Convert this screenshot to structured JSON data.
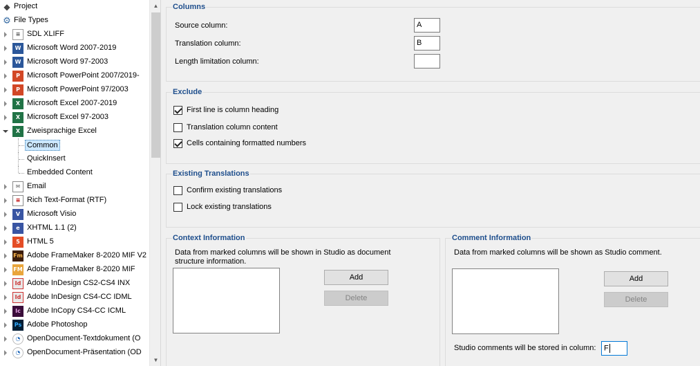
{
  "tree": {
    "items": [
      {
        "label": "Project",
        "icon": "project-icon",
        "cls": "ic-proj",
        "glyph": "◆",
        "depth": 0,
        "arrow": "none"
      },
      {
        "label": "File Types",
        "icon": "gear-icon",
        "cls": "ic-gear",
        "glyph": "⚙",
        "depth": 0,
        "arrow": "none"
      },
      {
        "label": "SDL XLIFF",
        "icon": "sdl-xliff-icon",
        "cls": "ic-plain",
        "glyph": "≡",
        "depth": 1,
        "arrow": "closed"
      },
      {
        "label": "Microsoft Word 2007-2019",
        "icon": "word-icon",
        "cls": "ic-word",
        "glyph": "W",
        "depth": 1,
        "arrow": "closed"
      },
      {
        "label": "Microsoft Word 97-2003",
        "icon": "word-legacy-icon",
        "cls": "ic-word",
        "glyph": "W",
        "depth": 1,
        "arrow": "closed"
      },
      {
        "label": "Microsoft PowerPoint 2007/2019-",
        "icon": "powerpoint-icon",
        "cls": "ic-ppt",
        "glyph": "P",
        "depth": 1,
        "arrow": "closed"
      },
      {
        "label": "Microsoft PowerPoint 97/2003",
        "icon": "powerpoint-legacy-icon",
        "cls": "ic-ppt",
        "glyph": "P",
        "depth": 1,
        "arrow": "closed"
      },
      {
        "label": "Microsoft Excel 2007-2019",
        "icon": "excel-icon",
        "cls": "ic-xl",
        "glyph": "X",
        "depth": 1,
        "arrow": "closed"
      },
      {
        "label": "Microsoft Excel 97-2003",
        "icon": "excel-legacy-icon",
        "cls": "ic-xl",
        "glyph": "X",
        "depth": 1,
        "arrow": "closed"
      },
      {
        "label": "Zweisprachige Excel",
        "icon": "bilingual-excel-icon",
        "cls": "ic-xl",
        "glyph": "X",
        "depth": 1,
        "arrow": "open"
      },
      {
        "label": "Common",
        "icon": "",
        "cls": "",
        "glyph": "",
        "depth": 2,
        "arrow": "none",
        "selected": true
      },
      {
        "label": "QuickInsert",
        "icon": "",
        "cls": "",
        "glyph": "",
        "depth": 2,
        "arrow": "none"
      },
      {
        "label": "Embedded Content",
        "icon": "",
        "cls": "",
        "glyph": "",
        "depth": 2,
        "arrow": "none"
      },
      {
        "label": "Email",
        "icon": "email-icon",
        "cls": "ic-mail",
        "glyph": "✉",
        "depth": 1,
        "arrow": "closed"
      },
      {
        "label": "Rich Text-Format (RTF)",
        "icon": "rtf-icon",
        "cls": "ic-rtf",
        "glyph": "≡",
        "depth": 1,
        "arrow": "closed"
      },
      {
        "label": "Microsoft Visio",
        "icon": "visio-icon",
        "cls": "ic-visio",
        "glyph": "V",
        "depth": 1,
        "arrow": "closed"
      },
      {
        "label": "XHTML 1.1 (2)",
        "icon": "xhtml-icon",
        "cls": "ic-visio",
        "glyph": "e",
        "depth": 1,
        "arrow": "closed"
      },
      {
        "label": "HTML 5",
        "icon": "html5-icon",
        "cls": "ic-html",
        "glyph": "5",
        "depth": 1,
        "arrow": "closed"
      },
      {
        "label": "Adobe FrameMaker 8-2020 MIF V2",
        "icon": "framemaker-icon",
        "cls": "ic-fm",
        "glyph": "Fm",
        "depth": 1,
        "arrow": "closed"
      },
      {
        "label": "Adobe FrameMaker 8-2020 MIF",
        "icon": "framemaker-legacy-icon",
        "cls": "ic-fm2",
        "glyph": "FM",
        "depth": 1,
        "arrow": "closed"
      },
      {
        "label": "Adobe InDesign CS2-CS4 INX",
        "icon": "indesign-inx-icon",
        "cls": "ic-id",
        "glyph": "Id",
        "depth": 1,
        "arrow": "closed"
      },
      {
        "label": "Adobe InDesign CS4-CC IDML",
        "icon": "indesign-idml-icon",
        "cls": "ic-id",
        "glyph": "Id",
        "depth": 1,
        "arrow": "closed"
      },
      {
        "label": "Adobe InCopy CS4-CC ICML",
        "icon": "incopy-icon",
        "cls": "ic-ic",
        "glyph": "Ic",
        "depth": 1,
        "arrow": "closed"
      },
      {
        "label": "Adobe Photoshop",
        "icon": "photoshop-icon",
        "cls": "ic-ps",
        "glyph": "Ps",
        "depth": 1,
        "arrow": "closed"
      },
      {
        "label": "OpenDocument-Textdokument (O",
        "icon": "opendocument-text-icon",
        "cls": "ic-odt",
        "glyph": "◔",
        "depth": 1,
        "arrow": "closed"
      },
      {
        "label": "OpenDocument-Präsentation (OD",
        "icon": "opendocument-presentation-icon",
        "cls": "ic-odt",
        "glyph": "◔",
        "depth": 1,
        "arrow": "closed"
      }
    ]
  },
  "columns": {
    "title": "Columns",
    "source_label": "Source column:",
    "source_value": "A",
    "translation_label": "Translation column:",
    "translation_value": "B",
    "length_label": "Length limitation column:",
    "length_value": ""
  },
  "exclude": {
    "title": "Exclude",
    "options": [
      {
        "label": "First line is column heading",
        "checked": true
      },
      {
        "label": "Translation column content",
        "checked": false
      },
      {
        "label": "Cells containing formatted numbers",
        "checked": true
      }
    ]
  },
  "existing": {
    "title": "Existing Translations",
    "options": [
      {
        "label": "Confirm existing translations",
        "checked": false
      },
      {
        "label": "Lock existing translations",
        "checked": false
      }
    ]
  },
  "context": {
    "title": "Context Information",
    "description": "Data from marked columns will be shown in Studio as document structure information.",
    "add_label": "Add",
    "delete_label": "Delete"
  },
  "comment": {
    "title": "Comment Information",
    "description": "Data from marked columns will be shown as Studio comment.",
    "add_label": "Add",
    "delete_label": "Delete",
    "store_label": "Studio comments will be stored in column:",
    "store_value": "F"
  },
  "colors": {
    "group_title": "#1e4e8c",
    "selection": "#cce8ff"
  }
}
